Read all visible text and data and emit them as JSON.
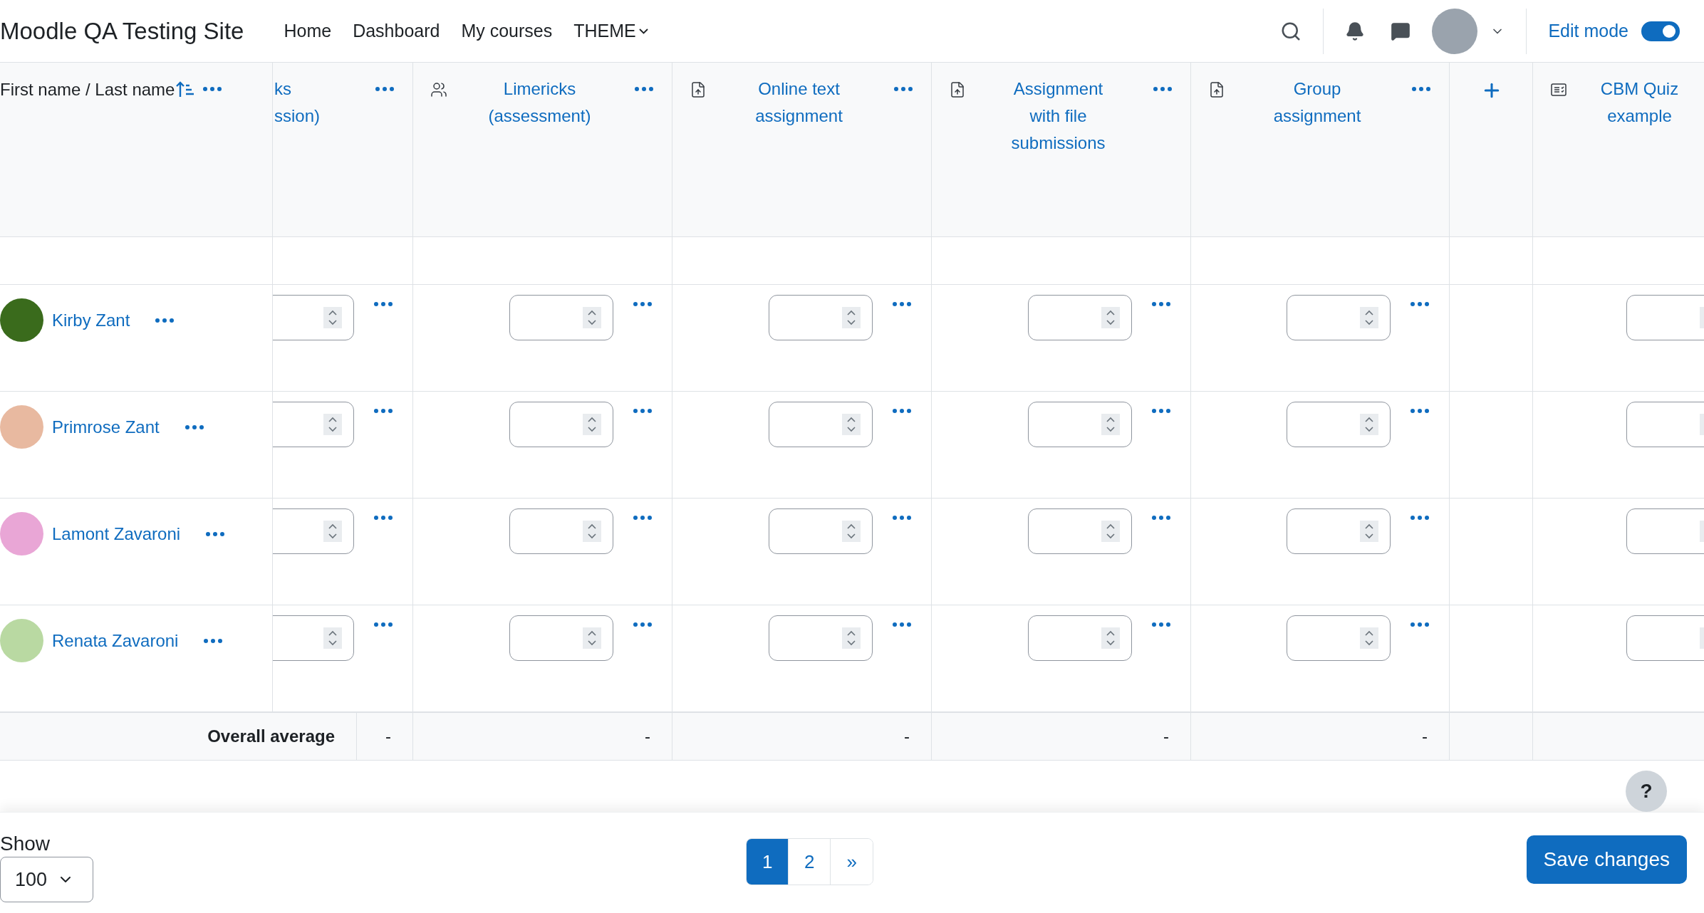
{
  "header": {
    "site_name": "Moodle QA Testing Site",
    "nav": [
      {
        "label": "Home",
        "dropdown": false
      },
      {
        "label": "Dashboard",
        "dropdown": false
      },
      {
        "label": "My courses",
        "dropdown": false
      },
      {
        "label": "THEME",
        "dropdown": true
      }
    ],
    "edit_mode": {
      "label": "Edit mode",
      "on": true
    }
  },
  "table": {
    "name_column": {
      "title": "First name / Last name"
    },
    "columns": [
      {
        "kind": "plain",
        "title": "ks\nssion)",
        "menu": true
      },
      {
        "kind": "group",
        "title": "Limericks\n(assessment)",
        "menu": true
      },
      {
        "kind": "upload",
        "title": "Online text\nassignment",
        "menu": true
      },
      {
        "kind": "upload",
        "title": "Assignment\nwith file\nsubmissions",
        "menu": true
      },
      {
        "kind": "upload",
        "title": "Group\nassignment",
        "menu": true
      },
      {
        "kind": "add"
      },
      {
        "kind": "list",
        "title": "CBM Quiz\nexample",
        "menu": false
      }
    ],
    "rows": [
      {
        "name": "Kirby Zant",
        "color": "#3a6b1c"
      },
      {
        "name": "Primrose Zant",
        "color": "#e8b9a0"
      },
      {
        "name": "Lamont Zavaroni",
        "color": "#e9a6d6"
      },
      {
        "name": "Renata Zavaroni",
        "color": "#b9d9a2"
      }
    ],
    "footer": {
      "label": "Overall average",
      "values": [
        "-",
        "-",
        "-",
        "-",
        "-"
      ]
    }
  },
  "help": {
    "label": "?"
  },
  "bottom": {
    "show_label": "Show",
    "per_page": "100",
    "pages": [
      {
        "label": "1",
        "selected": true
      },
      {
        "label": "2",
        "selected": false
      },
      {
        "label": "»",
        "selected": false
      }
    ],
    "save": "Save changes"
  }
}
